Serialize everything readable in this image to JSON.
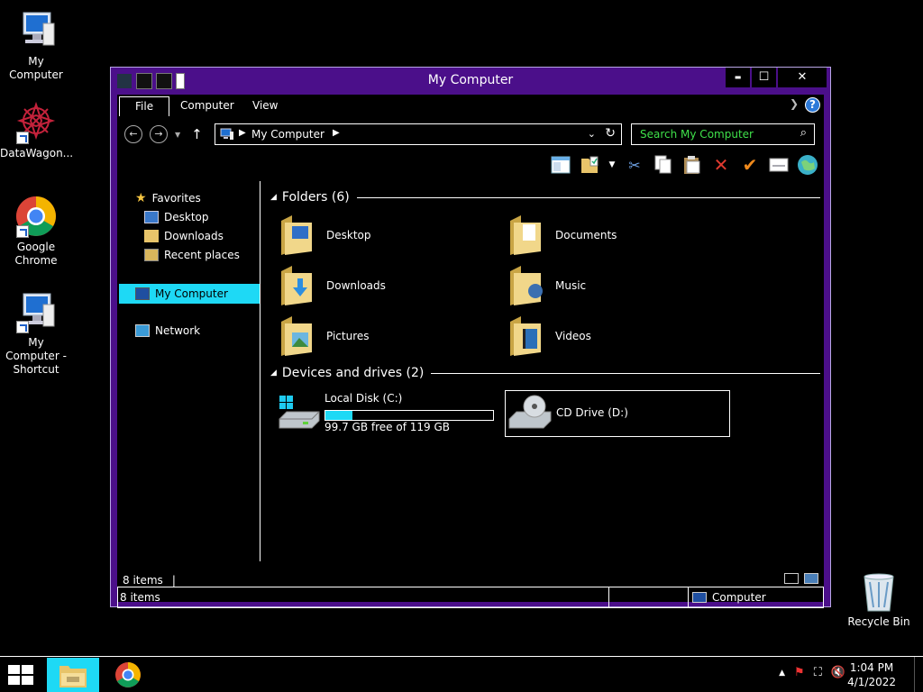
{
  "desktop": {
    "icons": [
      {
        "label": "My Computer"
      },
      {
        "label": "DataWagon..."
      },
      {
        "label": "Google Chrome"
      },
      {
        "label": "My Computer - Shortcut"
      },
      {
        "label": "Recycle Bin"
      }
    ]
  },
  "window": {
    "title": "My Computer",
    "controls": {
      "minimize": "▬",
      "maximize": "☐",
      "close": "✕"
    },
    "tabs": [
      {
        "label": "File",
        "active": true
      },
      {
        "label": "Computer",
        "active": false
      },
      {
        "label": "View",
        "active": false
      }
    ],
    "address": {
      "crumb": "My Computer"
    },
    "search": {
      "placeholder": "Search My Computer"
    },
    "nav_pane": {
      "favorites": "Favorites",
      "desktop": "Desktop",
      "downloads": "Downloads",
      "recent": "Recent places",
      "my_computer": "My Computer",
      "network": "Network"
    },
    "content": {
      "folders_header": "Folders (6)",
      "folders": [
        {
          "name": "Desktop"
        },
        {
          "name": "Documents"
        },
        {
          "name": "Downloads"
        },
        {
          "name": "Music"
        },
        {
          "name": "Pictures"
        },
        {
          "name": "Videos"
        }
      ],
      "drives_header": "Devices and drives (2)",
      "drives": [
        {
          "name": "Local Disk (C:)",
          "free_text": "99.7 GB free of 119 GB",
          "used_fraction": 0.16
        },
        {
          "name": "CD Drive (D:)"
        }
      ]
    },
    "footer_count": "8 items",
    "status": {
      "items": "8 items",
      "location": "Computer"
    }
  },
  "taskbar": {
    "time": "1:04 PM",
    "date": "4/1/2022"
  },
  "colors": {
    "accent": "#1ed9f5",
    "frame": "#4b0f8a",
    "search_text": "#3fe04a"
  }
}
